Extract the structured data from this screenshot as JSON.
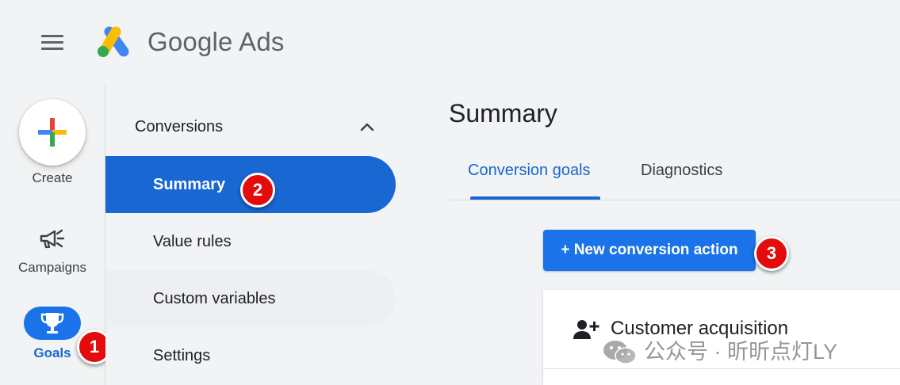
{
  "header": {
    "brand_name": "Google Ads"
  },
  "rail": {
    "create_label": "Create",
    "campaigns_label": "Campaigns",
    "goals_label": "Goals"
  },
  "secondary_nav": {
    "heading": "Conversions",
    "items": [
      {
        "label": "Summary",
        "active": true
      },
      {
        "label": "Value rules",
        "active": false
      },
      {
        "label": "Custom variables",
        "active": false
      },
      {
        "label": "Settings",
        "active": false
      }
    ]
  },
  "main": {
    "title": "Summary",
    "tabs": [
      {
        "label": "Conversion goals",
        "active": true
      },
      {
        "label": "Diagnostics",
        "active": false
      }
    ],
    "new_action_label": "+ New conversion action",
    "card_title": "Customer acquisition"
  },
  "markers": [
    "1",
    "2",
    "3"
  ],
  "watermark": "公众号 · 昕昕点灯LY",
  "icons": {
    "menu": "hamburger-menu-icon",
    "logo": "google-ads-logo",
    "create": "plus-multicolor-icon",
    "campaigns": "megaphone-icon",
    "goals": "trophy-icon",
    "expand": "chevron-up-icon",
    "card": "person-add-icon",
    "watermark": "wechat-icon"
  },
  "colors": {
    "accent_blue": "#1a73e8",
    "active_nav": "#1967d2",
    "marker_red": "#e30b0b",
    "background": "#f1f3f4",
    "google_blue": "#4285f4",
    "google_red": "#ea4335",
    "google_yellow": "#fbbc04",
    "google_green": "#34a853"
  }
}
